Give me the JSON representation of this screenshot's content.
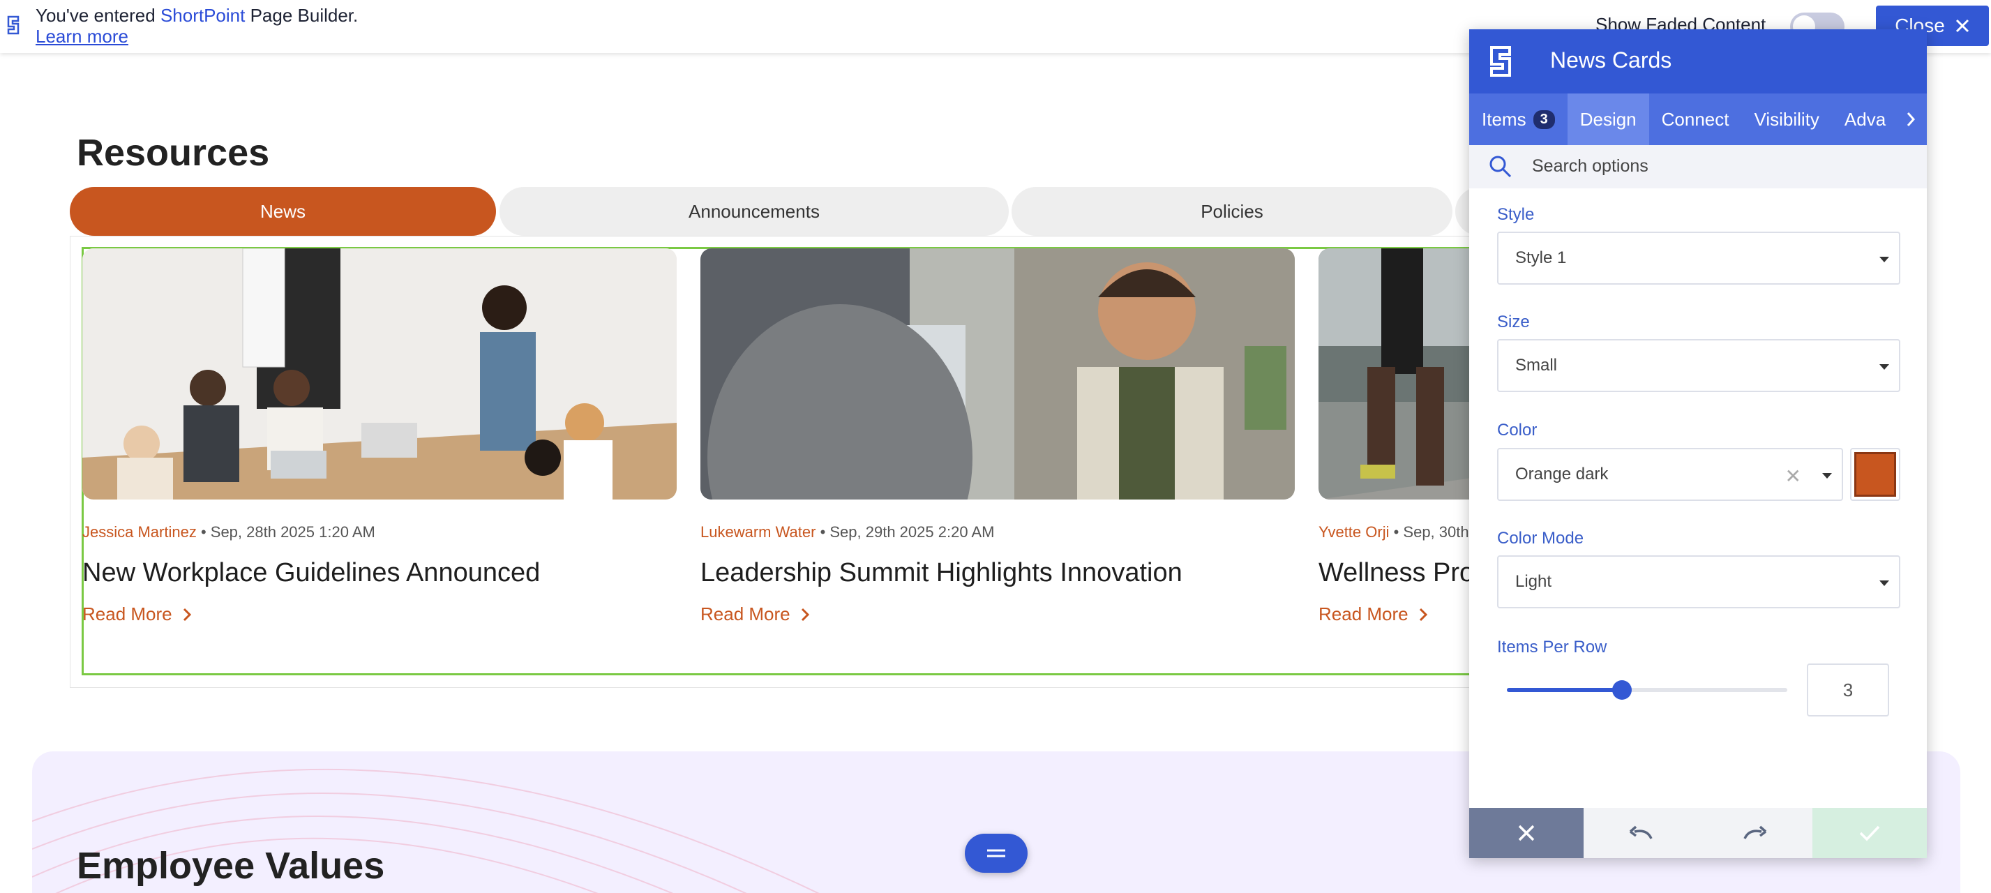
{
  "topbar": {
    "message_prefix": "You've entered ",
    "brand": "ShortPoint",
    "message_suffix": " Page Builder.",
    "learn_more": "Learn more",
    "show_faded": "Show Faded Content",
    "show_faded_on": false,
    "close_label": "Close"
  },
  "resources": {
    "title": "Resources",
    "tabs": [
      "News",
      "Announcements",
      "Policies"
    ],
    "active_tab": "News",
    "cards": [
      {
        "author": "Jessica Martinez",
        "date": " • Sep, 28th 2025 1:20 AM",
        "title": "New Workplace Guidelines Announced",
        "link": "Read More"
      },
      {
        "author": "Lukewarm Water",
        "date": " • Sep, 29th 2025 2:20 AM",
        "title": "Leadership Summit Highlights Innovation",
        "link": "Read More"
      },
      {
        "author": "Yvette Orji",
        "date": " • Sep, 30th",
        "title": "Wellness Prog",
        "link": "Read More"
      }
    ]
  },
  "values": {
    "title": "Employee Values"
  },
  "panel": {
    "title": "News Cards",
    "tabs": {
      "items": "Items",
      "items_count": "3",
      "design": "Design",
      "connect": "Connect",
      "visibility": "Visibility",
      "advanced": "Adva"
    },
    "search_placeholder": "Search options",
    "style": {
      "label": "Style",
      "value": "Style 1"
    },
    "size": {
      "label": "Size",
      "value": "Small"
    },
    "color": {
      "label": "Color",
      "value": "Orange dark",
      "swatch": "#c8561f"
    },
    "color_mode": {
      "label": "Color Mode",
      "value": "Light"
    },
    "items_per_row": {
      "label": "Items Per Row",
      "value": "3",
      "slider_fraction": 0.41
    }
  },
  "colors": {
    "accent": "#3358d4",
    "brand_orange": "#c8561f",
    "frame_green": "#7ac943"
  }
}
